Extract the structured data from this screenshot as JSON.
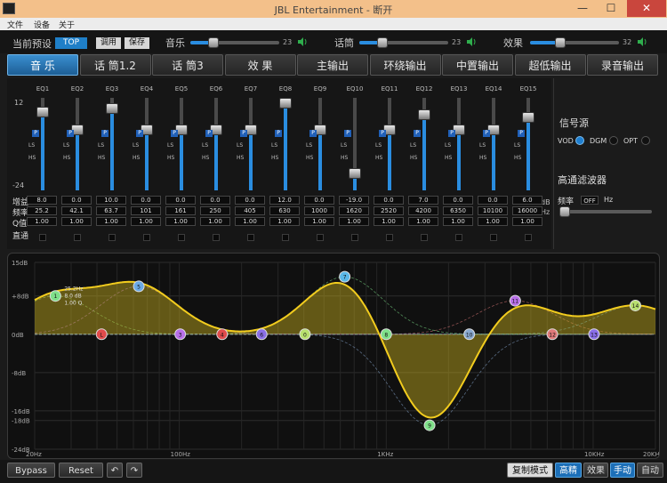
{
  "window": {
    "title": "JBL Entertainment - 断开",
    "minimize": "—",
    "maximize": "☐",
    "close": "✕"
  },
  "menu": [
    "文件",
    "设备",
    "关于"
  ],
  "topbar": {
    "preset_label": "当前预设",
    "preset_value": "TOP",
    "apply_label": "调用",
    "save_label": "保存",
    "sliders": [
      {
        "label": "音乐",
        "value": 23,
        "fraction": 0.23
      },
      {
        "label": "话筒",
        "value": 23,
        "fraction": 0.23
      },
      {
        "label": "效果",
        "value": 32,
        "fraction": 0.32
      }
    ]
  },
  "tabs": [
    {
      "label": "音 乐",
      "active": true
    },
    {
      "label": "话 筒1.2",
      "active": false
    },
    {
      "label": "话 筒3",
      "active": false
    },
    {
      "label": "效 果",
      "active": false
    },
    {
      "label": "主输出",
      "active": false
    },
    {
      "label": "环绕输出",
      "active": false
    },
    {
      "label": "中置输出",
      "active": false
    },
    {
      "label": "超低输出",
      "active": false
    },
    {
      "label": "录音输出",
      "active": false
    }
  ],
  "eq": {
    "scale_top": "12",
    "scale_bottom": "-24",
    "row_labels": {
      "gain": "增益",
      "freq": "频率",
      "q": "Q值",
      "bypass": "直通"
    },
    "units": {
      "gain": "dB",
      "freq": "Hz"
    },
    "btn_p": "P",
    "ls": "LS",
    "hs": "HS",
    "bands": [
      {
        "name": "EQ1",
        "gain": "8.0",
        "freq": "25.2",
        "q": "1.00",
        "level": 0.89
      },
      {
        "name": "EQ2",
        "gain": "0.0",
        "freq": "42.1",
        "q": "1.00",
        "level": 0.67
      },
      {
        "name": "EQ3",
        "gain": "10.0",
        "freq": "63.7",
        "q": "1.00",
        "level": 0.94
      },
      {
        "name": "EQ4",
        "gain": "0.0",
        "freq": "101",
        "q": "1.00",
        "level": 0.67
      },
      {
        "name": "EQ5",
        "gain": "0.0",
        "freq": "161",
        "q": "1.00",
        "level": 0.67
      },
      {
        "name": "EQ6",
        "gain": "0.0",
        "freq": "250",
        "q": "1.00",
        "level": 0.67
      },
      {
        "name": "EQ7",
        "gain": "0.0",
        "freq": "405",
        "q": "1.00",
        "level": 0.67
      },
      {
        "name": "EQ8",
        "gain": "12.0",
        "freq": "630",
        "q": "1.00",
        "level": 1.0
      },
      {
        "name": "EQ9",
        "gain": "0.0",
        "freq": "1000",
        "q": "1.00",
        "level": 0.67
      },
      {
        "name": "EQ10",
        "gain": "-19.0",
        "freq": "1620",
        "q": "1.00",
        "level": 0.14
      },
      {
        "name": "EQ11",
        "gain": "0.0",
        "freq": "2520",
        "q": "1.00",
        "level": 0.67
      },
      {
        "name": "EQ12",
        "gain": "7.0",
        "freq": "4200",
        "q": "1.00",
        "level": 0.86
      },
      {
        "name": "EQ13",
        "gain": "0.0",
        "freq": "6350",
        "q": "1.00",
        "level": 0.67
      },
      {
        "name": "EQ14",
        "gain": "0.0",
        "freq": "10100",
        "q": "1.00",
        "level": 0.67
      },
      {
        "name": "EQ15",
        "gain": "6.0",
        "freq": "16000",
        "q": "1.00",
        "level": 0.83
      }
    ]
  },
  "source": {
    "title": "信号源",
    "options": [
      {
        "label": "VOD",
        "selected": true
      },
      {
        "label": "DGM",
        "selected": false
      },
      {
        "label": "OPT",
        "selected": false
      }
    ]
  },
  "hpf": {
    "title": "高通滤波器",
    "freq_label": "频率",
    "value": "OFF",
    "unit": "Hz",
    "level": 0.0
  },
  "graph": {
    "y_ticks": [
      "15dB",
      "+8dB",
      "0dB",
      "-8dB",
      "-16dB",
      "-18dB",
      "-24dB"
    ],
    "x_ticks": [
      "20Hz",
      "100Hz",
      "1KHz",
      "10KHz",
      "20KHz"
    ],
    "tooltip": [
      "25.2Hz",
      "8.0 dB",
      "1.00 Q"
    ],
    "points": [
      {
        "id": "1",
        "color": "#7fe08a"
      },
      {
        "id": "L",
        "color": "#e04b4b"
      },
      {
        "id": "5",
        "color": "#6aa9e6"
      },
      {
        "id": "3",
        "color": "#b86fe8"
      },
      {
        "id": "4",
        "color": "#e04b4b"
      },
      {
        "id": "6",
        "color": "#8a6fe8"
      },
      {
        "id": "0",
        "color": "#b8e06f"
      },
      {
        "id": "7",
        "color": "#5ab8e8"
      },
      {
        "id": "8",
        "color": "#7fe08a"
      },
      {
        "id": "9",
        "color": "#7fe08a"
      },
      {
        "id": "10",
        "color": "#88a8d0"
      },
      {
        "id": "11",
        "color": "#b86fe8"
      },
      {
        "id": "12",
        "color": "#e07a7a"
      },
      {
        "id": "13",
        "color": "#8a6fe8"
      },
      {
        "id": "14",
        "color": "#b8e06f"
      },
      {
        "id": "15",
        "color": "#5ab8e8"
      }
    ]
  },
  "bottom": {
    "bypass": "Bypass",
    "reset": "Reset",
    "undo": "↶",
    "redo": "↷",
    "copy": "复制模式",
    "mode_right": [
      "高精",
      "效果",
      "手动",
      "自动"
    ]
  }
}
